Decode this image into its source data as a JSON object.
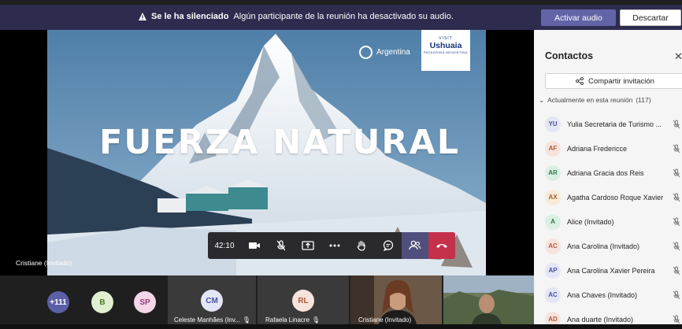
{
  "notification": {
    "bold": "Se le ha silenciado",
    "text": "Algún participante de la reunión ha desactivado su audio.",
    "activate_label": "Activar audio",
    "dismiss_label": "Descartar"
  },
  "slide": {
    "slogan": "FUERZA NATURAL",
    "country_logo": "Argentina",
    "brand_top": "VISIT",
    "brand": "Ushuaia",
    "brand_sub": "PATAGONIA ARGENTINA"
  },
  "stage_participant": "Cristiane (Invitado)",
  "controls": {
    "timer": "42:10",
    "buttons": [
      "camera-icon",
      "mic-muted-icon",
      "share-screen-icon",
      "more-icon",
      "raise-hand-icon",
      "chat-icon",
      "participants-icon",
      "hang-up-icon"
    ]
  },
  "panel": {
    "title": "Contactos",
    "share_label": "Compartir invitación",
    "section_label": "Actualmente en esta reunión",
    "count": "(117)",
    "participants": [
      {
        "initials": "YU",
        "name": "Yulia Secretaria de Turismo ...",
        "bg": "#e3e6f5",
        "fg": "#4a52a6"
      },
      {
        "initials": "AF",
        "name": "Adriana Fredericce",
        "bg": "#f6e3dc",
        "fg": "#b05a3d"
      },
      {
        "initials": "AR",
        "name": "Adriana Gracia dos Reis",
        "bg": "#dcefe3",
        "fg": "#2f7a4c"
      },
      {
        "initials": "AX",
        "name": "Agatha Cardoso Roque Xavier",
        "bg": "#f7ead8",
        "fg": "#a3642a"
      },
      {
        "initials": "A",
        "name": "Alice (Invitado)",
        "bg": "#dcefe3",
        "fg": "#2f7a4c"
      },
      {
        "initials": "AC",
        "name": "Ana Carolina (Invitado)",
        "bg": "#f6e3dc",
        "fg": "#b05a3d"
      },
      {
        "initials": "AP",
        "name": "Ana Carolina Xavier Pereira",
        "bg": "#e3e6f5",
        "fg": "#4a52a6"
      },
      {
        "initials": "AC",
        "name": "Ana Chaves (Invitado)",
        "bg": "#e3e6f5",
        "fg": "#4a52a6"
      },
      {
        "initials": "AD",
        "name": "Ana duarte (Invitado)",
        "bg": "#f6e3dc",
        "fg": "#b05a3d"
      }
    ]
  },
  "gallery": {
    "overflow": "+111",
    "avatars": [
      {
        "initials": "B",
        "bg": "#dfefcf",
        "fg": "#4d7a2a"
      },
      {
        "initials": "SP",
        "bg": "#f3d7e9",
        "fg": "#9a3a7a"
      }
    ],
    "tiles": [
      {
        "initials": "CM",
        "name": "Celeste Manhães (Inv...",
        "bg": "#e3e6f5",
        "fg": "#4a52a6"
      },
      {
        "initials": "RL",
        "name": "Rafaela Linacre",
        "bg": "#f6e3dc",
        "fg": "#b05a3d"
      },
      {
        "name": "Cristiane (Invitado)"
      }
    ]
  }
}
